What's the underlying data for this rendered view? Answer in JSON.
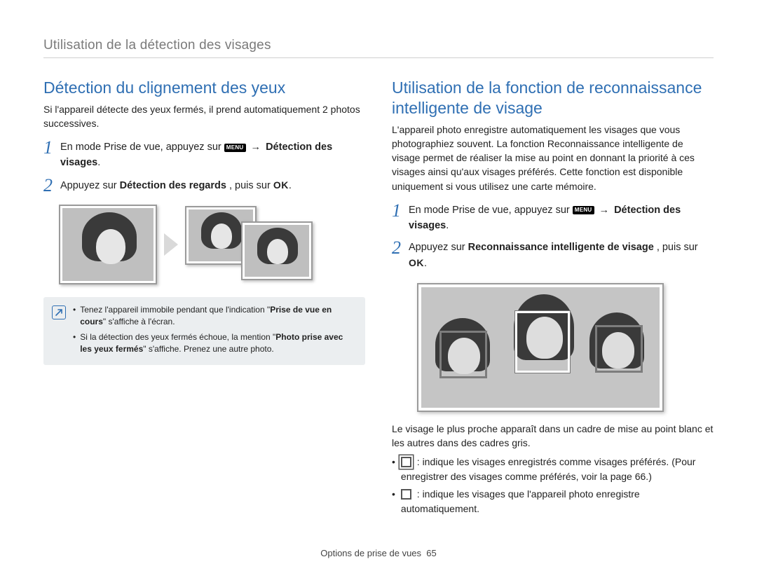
{
  "header": "Utilisation de la détection des visages",
  "left": {
    "title": "Détection du clignement des yeux",
    "intro": "Si l'appareil détecte des yeux fermés, il prend automatiquement 2 photos successives.",
    "step1_pre": "En mode Prise de vue, appuyez sur ",
    "menu_label": "MENU",
    "arrow": "→",
    "step1_post1": " Détection des visages",
    "step2_pre": "Appuyez sur ",
    "step2_bold": "Détection des regards",
    "step2_post": ", puis sur ",
    "ok_label": "OK",
    "note1_pre": "Tenez l'appareil immobile pendant que l'indication \"",
    "note1_bold": "Prise de vue en cours",
    "note1_post": "\" s'affiche à l'écran.",
    "note2_pre": "Si la détection des yeux fermés échoue, la mention \"",
    "note2_bold": "Photo prise avec les yeux fermés",
    "note2_post": "\" s'affiche. Prenez une autre photo."
  },
  "right": {
    "title": "Utilisation de la fonction de reconnaissance intelligente de visage",
    "intro": "L'appareil photo enregistre automatiquement les visages que vous photographiez souvent. La fonction Reconnaissance intelligente de visage permet de réaliser la mise au point en donnant la priorité à ces visages ainsi qu'aux visages préférés. Cette fonction est disponible uniquement si vous utilisez une carte mémoire.",
    "step1_pre": "En mode Prise de vue, appuyez sur ",
    "menu_label": "MENU",
    "arrow": "→",
    "step1_post1": " Détection des visages",
    "step2_pre": "Appuyez sur ",
    "step2_bold": "Reconnaissance intelligente de visage",
    "step2_post": ", puis sur ",
    "ok_label": "OK",
    "focus_text": "Le visage le plus proche apparaît dans un cadre de mise au point blanc et les autres dans des cadres gris.",
    "bullet1": " : indique les visages enregistrés comme visages préférés. (Pour enregistrer des visages comme préférés, voir la page 66.)",
    "bullet2": " : indique les visages que l'appareil photo enregistre automatiquement."
  },
  "footer_text": "Options de prise de vues",
  "footer_page": "65"
}
